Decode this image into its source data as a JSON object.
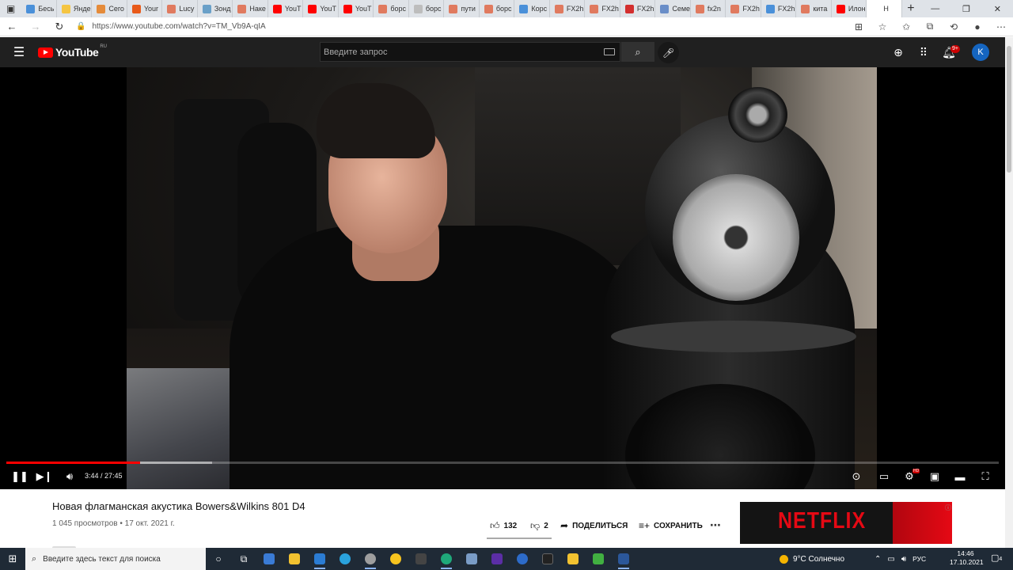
{
  "browser": {
    "tabs": [
      {
        "label": "Бесь",
        "color": "#4a90d9"
      },
      {
        "label": "Янде",
        "color": "#f5c542"
      },
      {
        "label": "Сего",
        "color": "#e58b3a"
      },
      {
        "label": "Your",
        "color": "#e85a1a"
      },
      {
        "label": "Lucy",
        "color": "#e07a5f"
      },
      {
        "label": "Зонд",
        "color": "#6aa0c8"
      },
      {
        "label": "Наке",
        "color": "#e07a5f"
      },
      {
        "label": "YouT",
        "color": "#ff0000"
      },
      {
        "label": "YouT",
        "color": "#ff0000"
      },
      {
        "label": "YouT",
        "color": "#ff0000"
      },
      {
        "label": "борс",
        "color": "#e07a5f"
      },
      {
        "label": "борс",
        "color": "#bdbdbd"
      },
      {
        "label": "пути",
        "color": "#e07a5f"
      },
      {
        "label": "борс",
        "color": "#e07a5f"
      },
      {
        "label": "Корс",
        "color": "#4a90d9"
      },
      {
        "label": "FX2h",
        "color": "#e07a5f"
      },
      {
        "label": "FX2h",
        "color": "#e07a5f"
      },
      {
        "label": "FX2h",
        "color": "#d32f2f"
      },
      {
        "label": "Семе",
        "color": "#6a8ec8"
      },
      {
        "label": "fx2n",
        "color": "#e07a5f"
      },
      {
        "label": "FX2h",
        "color": "#e07a5f"
      },
      {
        "label": "FX2h",
        "color": "#4a90d9"
      },
      {
        "label": "кита",
        "color": "#e07a5f"
      },
      {
        "label": "Илон",
        "color": "#ff0000"
      },
      {
        "label": "Н",
        "color": "#ffffff"
      }
    ],
    "url": "https://www.youtube.com/watch?v=TM_Vb9A-qIA"
  },
  "youtube": {
    "logo_text": "YouTube",
    "logo_region": "RU",
    "search_placeholder": "Введите запрос",
    "notifications_badge": "9+",
    "avatar_letter": "K"
  },
  "player": {
    "current_time": "3:44",
    "duration": "27:45",
    "time_display": "3:44 / 27:45",
    "played_fraction": 0.1345,
    "buffered_fraction": 0.2073,
    "hd_badge": "HD"
  },
  "video": {
    "title": "Новая флагманская акустика Bowers&Wilkins 801 D4",
    "meta": "1 045 просмотров • 17 окт. 2021 г.",
    "likes": "132",
    "dislikes": "2",
    "share_label": "ПОДЕЛИТЬСЯ",
    "save_label": "СОХРАНИТЬ"
  },
  "ad": {
    "brand": "NETFLIX"
  },
  "taskbar": {
    "search_placeholder": "Введите здесь текст для поиска",
    "weather": "9°C Солнечно",
    "language": "РУС",
    "time": "14:46",
    "date": "17.10.2021",
    "notification_count": "4"
  }
}
